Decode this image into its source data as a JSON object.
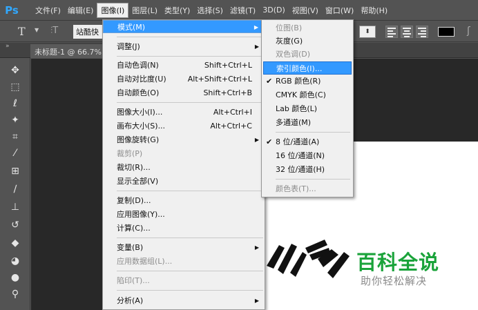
{
  "app": {
    "logo": "Ps"
  },
  "menubar": {
    "items": [
      "文件(F)",
      "编辑(E)",
      "图像(I)",
      "图层(L)",
      "类型(Y)",
      "选择(S)",
      "滤镜(T)",
      "3D(D)",
      "视图(V)",
      "窗口(W)",
      "帮助(H)"
    ],
    "active_index": 2
  },
  "options": {
    "tool_glyph": "T",
    "font_value": "站酷快"
  },
  "document": {
    "tab_title": "未标题-1 @ 66.7%"
  },
  "image_menu": {
    "mode": "模式(M)",
    "adjust": "调整(J)",
    "auto_tone": "自动色调(N)",
    "auto_tone_sc": "Shift+Ctrl+L",
    "auto_contrast": "自动对比度(U)",
    "auto_contrast_sc": "Alt+Shift+Ctrl+L",
    "auto_color": "自动颜色(O)",
    "auto_color_sc": "Shift+Ctrl+B",
    "image_size": "图像大小(I)...",
    "image_size_sc": "Alt+Ctrl+I",
    "canvas_size": "画布大小(S)...",
    "canvas_size_sc": "Alt+Ctrl+C",
    "image_rotation": "图像旋转(G)",
    "crop": "裁剪(P)",
    "trim": "裁切(R)...",
    "reveal_all": "显示全部(V)",
    "duplicate": "复制(D)...",
    "apply_image": "应用图像(Y)...",
    "calculations": "计算(C)...",
    "variables": "变量(B)",
    "apply_data_set": "应用数据组(L)...",
    "trap": "陷印(T)...",
    "analysis": "分析(A)"
  },
  "mode_submenu": {
    "bitmap": "位图(B)",
    "grayscale": "灰度(G)",
    "duotone": "双色调(D)",
    "indexed": "索引颜色(I)...",
    "rgb": "RGB 颜色(R)",
    "cmyk": "CMYK 颜色(C)",
    "lab": "Lab 颜色(L)",
    "multichannel": "多通道(M)",
    "bit8": "8 位/通道(A)",
    "bit16": "16 位/通道(N)",
    "bit32": "32 位/通道(H)",
    "color_table": "颜色表(T)...",
    "check": "✔"
  },
  "watermark": {
    "title": "百科全说",
    "subtitle": "助你轻松解决"
  },
  "colors": {
    "accent": "#3399ff",
    "watermark": "#1aa33a",
    "menu_bg": "#f0f0f0"
  }
}
